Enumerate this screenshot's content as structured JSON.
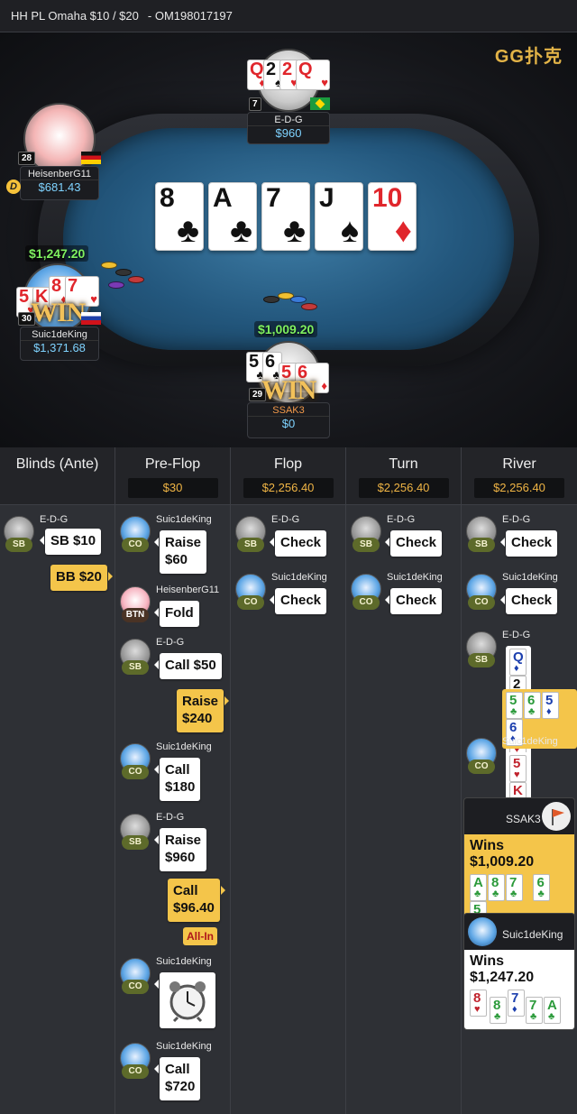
{
  "header": {
    "game": "HH PL Omaha $10 / $20",
    "hand_id": "- OM198017197"
  },
  "brand": "GG扑克",
  "board": [
    {
      "rank": "8",
      "suit": "♣",
      "color": "black"
    },
    {
      "rank": "A",
      "suit": "♣",
      "color": "black"
    },
    {
      "rank": "7",
      "suit": "♣",
      "color": "black"
    },
    {
      "rank": "J",
      "suit": "♠",
      "color": "black"
    },
    {
      "rank": "10",
      "suit": "♦",
      "color": "red"
    }
  ],
  "players": {
    "top": {
      "name": "E-D-G",
      "stack": "$960",
      "level": "7",
      "cards": [
        "Q",
        "2",
        "2",
        "Q"
      ]
    },
    "left_top": {
      "name": "HeisenberG11",
      "stack": "$681.43",
      "level": "28",
      "dealer": "D"
    },
    "left": {
      "name": "Suic1deKing",
      "stack": "$1,371.68",
      "level": "30",
      "won": "$1,247.20",
      "cards": [
        "5",
        "K",
        "8",
        "7"
      ],
      "badge": "WIN"
    },
    "bottom": {
      "name": "SSAK3",
      "stack": "$0",
      "level": "29",
      "cards": [
        "5",
        "6",
        "5",
        "6"
      ],
      "badge": "WIN"
    }
  },
  "pot_on_table": "$1,009.20",
  "streets": [
    {
      "title": "Blinds (Ante)",
      "pot": ""
    },
    {
      "title": "Pre-Flop",
      "pot": "$30"
    },
    {
      "title": "Flop",
      "pot": "$2,256.40"
    },
    {
      "title": "Turn",
      "pot": "$2,256.40"
    },
    {
      "title": "River",
      "pot": "$2,256.40"
    }
  ],
  "blinds": [
    {
      "player": "E-D-G",
      "pos": "SB",
      "action": "SB  $10"
    },
    {
      "action": "BB  $20"
    }
  ],
  "preflop": [
    {
      "player": "Suic1deKing",
      "pos": "CO",
      "line1": "Raise",
      "line2": "$60"
    },
    {
      "player": "HeisenberG11",
      "pos": "BTN",
      "line1": "Fold"
    },
    {
      "player": "E-D-G",
      "pos": "SB",
      "line1": "Call  $50"
    },
    {
      "line1": "Raise",
      "line2": "$240"
    },
    {
      "player": "Suic1deKing",
      "pos": "CO",
      "line1": "Call",
      "line2": "$180"
    },
    {
      "player": "E-D-G",
      "pos": "SB",
      "line1": "Raise",
      "line2": "$960"
    },
    {
      "line1": "Call",
      "line2": "$96.40",
      "tag": "All-In"
    },
    {
      "player": "Suic1deKing",
      "pos": "CO",
      "icon": "alarm-clock-icon"
    },
    {
      "player": "Suic1deKing",
      "pos": "CO",
      "line1": "Call",
      "line2": "$720"
    }
  ],
  "flop": [
    {
      "player": "E-D-G",
      "pos": "SB",
      "action": "Check"
    },
    {
      "player": "Suic1deKing",
      "pos": "CO",
      "action": "Check"
    }
  ],
  "turn": [
    {
      "player": "E-D-G",
      "pos": "SB",
      "action": "Check"
    },
    {
      "player": "Suic1deKing",
      "pos": "CO",
      "action": "Check"
    }
  ],
  "river": {
    "actions": [
      {
        "player": "E-D-G",
        "pos": "SB",
        "action": "Check"
      },
      {
        "player": "Suic1deKing",
        "pos": "CO",
        "action": "Check"
      }
    ],
    "show_edg": {
      "player": "E-D-G",
      "pos": "SB",
      "cards": [
        "Q",
        "2",
        "2",
        "Q"
      ]
    },
    "show_ssak": {
      "cards": [
        "5",
        "6",
        "5",
        "6"
      ]
    },
    "show_suic": {
      "player": "Suic1deKing",
      "pos": "CO",
      "cards": [
        "5",
        "K",
        "8",
        "7"
      ]
    },
    "winners": [
      {
        "player": "SSAK3",
        "text": "Wins $1,009.20",
        "cards": [
          "A",
          "8",
          "7",
          "6",
          "5"
        ]
      },
      {
        "player": "Suic1deKing",
        "text": "Wins $1,247.20",
        "cards": [
          "8",
          "8",
          "7",
          "7",
          "A"
        ]
      }
    ]
  }
}
